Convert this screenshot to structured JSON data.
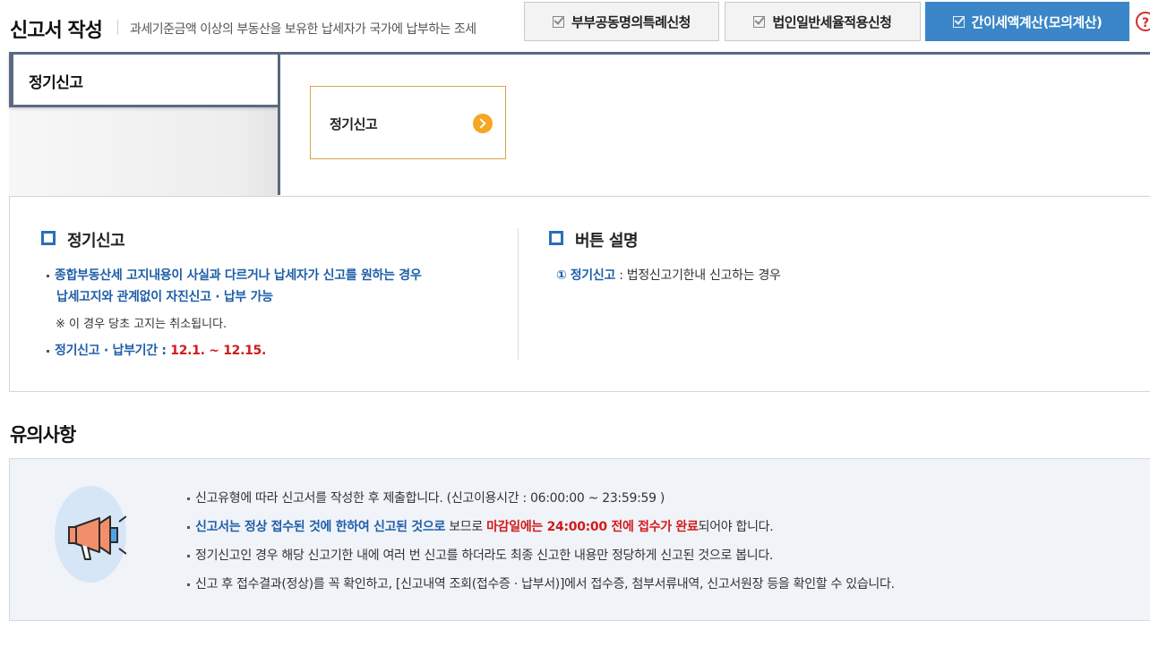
{
  "header": {
    "title": "신고서 작성",
    "description": "과세기준금액 이상의 부동산을 보유한 납세자가 국가에 납부하는 조세",
    "buttons": [
      {
        "label": "부부공동명의특례신청"
      },
      {
        "label": "법인일반세율적용신청"
      },
      {
        "label": "간이세액계산(모의계산)"
      }
    ],
    "help": "?"
  },
  "tabs": {
    "active_label": "정기신고",
    "option_label": "정기신고"
  },
  "info": {
    "left": {
      "title": "정기신고",
      "bullet1_line1": "종합부동산세 고지내용이 사실과 다르거나 납세자가 신고를 원하는 경우",
      "bullet1_line2": "납세고지와 관계없이 자진신고 · 납부 가능",
      "note": "※ 이 경우 당초 고지는 취소됩니다.",
      "bullet2_label": "정기신고 · 납부기간 : ",
      "bullet2_period": "12.1. ~ 12.15."
    },
    "right": {
      "title": "버튼 설명",
      "item_num": "①",
      "item_label": "정기신고",
      "item_desc": " : 법정신고기한내 신고하는 경우"
    }
  },
  "notice": {
    "title": "유의사항",
    "line1": "신고유형에 따라 신고서를 작성한 후 제출합니다. (신고이용시간 : 06:00:00 ~ 23:59:59 )",
    "line2_blue": "신고서는 정상 접수된 것에 한하여 신고된 것으로",
    "line2_mid": " 보므로 ",
    "line2_red": "마감일에는 24:00:00 전에 접수가 완료",
    "line2_end": "되어야 합니다.",
    "line3": "정기신고인 경우 해당 신고기한 내에 여러 번 신고를 하더라도 최종 신고한 내용만 정당하게 신고된 것으로 봅니다.",
    "line4": "신고 후 접수결과(정상)를 꼭 확인하고, [신고내역 조회(접수증 · 납부서)]에서 접수증, 첨부서류내역, 신고서원장 등을 확인할 수 있습니다."
  },
  "colors": {
    "primary": "#3a86c8",
    "tab_border": "#5a6a80",
    "accent_orange": "#f5a623",
    "text_blue": "#1e5ea8",
    "text_red": "#d11b1b"
  }
}
